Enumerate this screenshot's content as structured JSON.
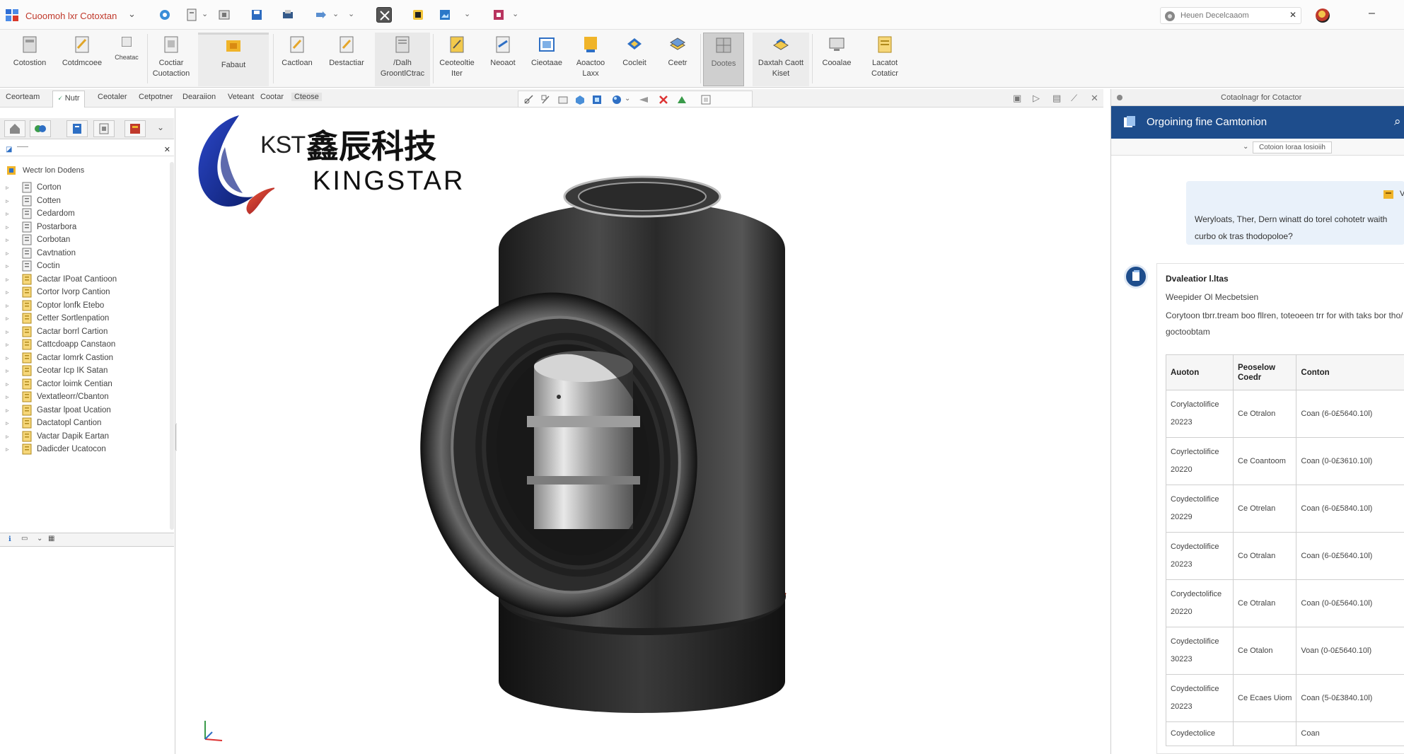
{
  "window": {
    "title": "Cuoomoh lxr Cotoxtan",
    "search_placeholder": "Heuen Decelcaaom"
  },
  "ribbon": {
    "buttons": [
      {
        "label": "Cotostion"
      },
      {
        "label": "Cotdmcoee"
      },
      {
        "label": "Cheatac"
      },
      {
        "label": "Coctiar Cuotaction"
      },
      {
        "label": "Fabaut"
      },
      {
        "label": "Cactloan"
      },
      {
        "label": "Destactiar"
      },
      {
        "label": "/Dalh GroontlCtrac"
      },
      {
        "label": "Ceoteoltie Iter"
      },
      {
        "label": "Neoaot"
      },
      {
        "label": "Cieotaae"
      },
      {
        "label": "Aoactoo Laxx"
      },
      {
        "label": "Cocleit"
      },
      {
        "label": "Ceetr"
      },
      {
        "label": "Dootes"
      },
      {
        "label": "Daxtah Caott Kiset"
      },
      {
        "label": "Cooalae"
      },
      {
        "label": "Lacatot Cotaticr"
      }
    ]
  },
  "command_tabs": [
    {
      "label": "Ceorteam"
    },
    {
      "label": "Nutr"
    },
    {
      "label": "Ceotaler"
    },
    {
      "label": "Cetpotner"
    },
    {
      "label": "Dearaiion"
    },
    {
      "label": "Veteant"
    },
    {
      "label": "Cootar"
    },
    {
      "label": "Cteose"
    }
  ],
  "left_panel": {
    "root": "Wectr lon Dodens",
    "items": [
      {
        "label": "Corton"
      },
      {
        "label": "Cotten"
      },
      {
        "label": "Cedardom"
      },
      {
        "label": "Postarbora"
      },
      {
        "label": "Corbotan"
      },
      {
        "label": "Cavtnation"
      },
      {
        "label": "Coctin"
      },
      {
        "label": "Cactar IPoat Cantioon"
      },
      {
        "label": "Cortor Ivorp Cantion"
      },
      {
        "label": "Coptor lonfk Etebo"
      },
      {
        "label": "Cetter Sortlenpation"
      },
      {
        "label": "Cactar borrl Cartion"
      },
      {
        "label": "Cattcdoapp Canstaon"
      },
      {
        "label": "Cactar Iomrk Castion"
      },
      {
        "label": "Ceotar Icp IK Satan"
      },
      {
        "label": "Cactor loimk Centian"
      },
      {
        "label": "Vextatleorr/Cbanton"
      },
      {
        "label": "Gastar lpoat Ucation"
      },
      {
        "label": "Dactatopl Cantion"
      },
      {
        "label": "Vactar Dapik Eartan"
      },
      {
        "label": "Dadicder Ucatocon"
      }
    ]
  },
  "brand": {
    "kst": "KST",
    "chinese": "鑫辰科技",
    "english": "KINGSTAR"
  },
  "right_panel": {
    "header": "Cotaolnagr for Cotactor",
    "title": "Orgoining fine Camtonion",
    "sub_tag": "Cotoion Ioraa Iosioiih",
    "user_tail": "Vo",
    "user_message": "Weryloats, Ther, Dern winatt do torel cohotetr waith curbo ok tras thodopoloe?",
    "assistant_title": "Dvaleatior l.ltas",
    "assistant_subtitle": "Weepider Ol Mecbetsien",
    "assistant_text": "Corytoon tbrr.tream boo fllren, toteoeen trr for with taks bor tho/ goctoobtam",
    "table": {
      "headers": [
        "Auoton",
        "Peoselow Coedr",
        "Conton"
      ],
      "rows": [
        [
          "Corylactolifice 20223",
          "Ce Otralon",
          "Coan (6-0£5640.10l)"
        ],
        [
          "Coyrlectolifice 20220",
          "Ce Coantoom",
          "Coan (0-0£3610.10l)"
        ],
        [
          "Coydectolifice 20229",
          "Ce Otrelan",
          "Coan (6-0£5840.10l)"
        ],
        [
          "Coydectolifice 20223",
          "Co Otralan",
          "Coan (6-0£5640.10l)"
        ],
        [
          "Corydectolifice 20220",
          "Ce Otralan",
          "Coan (0-0£5640.10l)"
        ],
        [
          "Coydectolifice 30223",
          "Ce Otalon",
          "Voan (0-0£5640.10l)"
        ],
        [
          "Coydectolifice 20223",
          "Ce Ecaes Uiom",
          "Coan (5-0£3840.10l)"
        ],
        [
          "Coydectolice",
          "",
          "Coan"
        ]
      ]
    }
  }
}
